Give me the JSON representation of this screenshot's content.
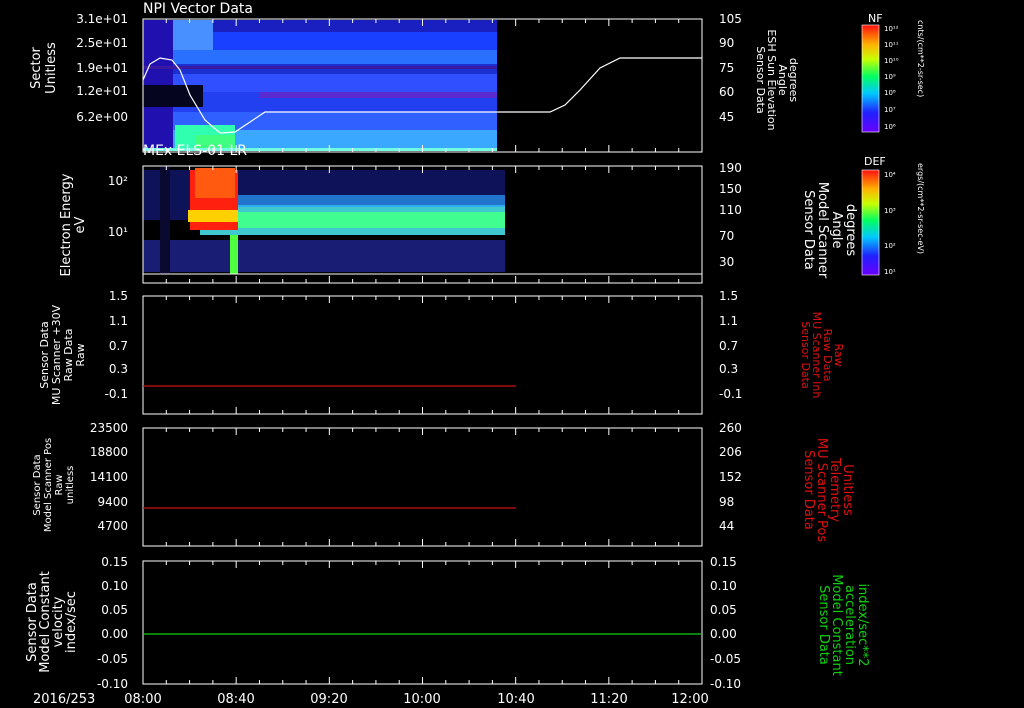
{
  "colors": {
    "background": "#000000",
    "axis": "#ffffff",
    "red_trace": "#d01010",
    "green_trace": "#10d010"
  },
  "time_axis": {
    "date": "2016/253",
    "ticks": [
      "08:00",
      "08:40",
      "09:20",
      "10:00",
      "10:40",
      "11:20",
      "12:00"
    ]
  },
  "panels": [
    {
      "title": "NPI Vector Data",
      "left_ylabel": [
        "Sector",
        "Unitless"
      ],
      "left_ticks": [
        "3.1e+01",
        "2.5e+01",
        "1.9e+01",
        "1.2e+01",
        "6.2e+00"
      ],
      "right_ylabel": [
        "Sensor Data",
        "ESH Sun Elevation",
        "Angle",
        "degrees"
      ],
      "right_ticks": [
        "105",
        "90",
        "75",
        "60",
        "45"
      ],
      "colorbar": {
        "label": "NF",
        "units": "cnts/(cm**2-sr-sec)",
        "ticks": [
          "10¹²",
          "10¹¹",
          "10¹⁰",
          "10⁹",
          "10⁸",
          "10⁷",
          "10⁶"
        ]
      }
    },
    {
      "title": "MEx ELS-01 LR",
      "left_ylabel": [
        "Electron Energy",
        "eV"
      ],
      "left_ticks": [
        "10²",
        "10¹"
      ],
      "right_ylabel": [
        "Sensor Data",
        "Model Scanner",
        "Angle",
        "degrees"
      ],
      "right_ticks": [
        "190",
        "150",
        "110",
        "70",
        "30"
      ],
      "colorbar": {
        "label": "DEF",
        "units": "ergs/(cm**2-sr-sec-eV)",
        "ticks": [
          "10⁴",
          "10³",
          "10²",
          "10¹"
        ]
      }
    },
    {
      "left_ylabel": [
        "Sensor Data",
        "MU Scanner +30V",
        "Raw Data",
        "Raw"
      ],
      "left_ticks": [
        "1.5",
        "1.1",
        "0.7",
        "0.3",
        "-0.1"
      ],
      "right_ylabel": [
        "Sensor Data",
        "MU Scanner Inh",
        "Raw Data",
        "Raw"
      ],
      "right_ticks": [
        "1.5",
        "1.1",
        "0.7",
        "0.3",
        "-0.1"
      ]
    },
    {
      "left_ylabel": [
        "Sensor Data",
        "Model Scanner Pos",
        "Raw",
        "unitless"
      ],
      "left_ticks": [
        "23500",
        "18800",
        "14100",
        "9400",
        "4700"
      ],
      "right_ylabel": [
        "Sensor Data",
        "MU Scanner Pos",
        "Telemetry",
        "Unitless"
      ],
      "right_ticks": [
        "260",
        "206",
        "152",
        "98",
        "44"
      ]
    },
    {
      "left_ylabel": [
        "Sensor Data",
        "Model Constant",
        "velocity",
        "index/sec"
      ],
      "left_ticks": [
        "0.15",
        "0.10",
        "0.05",
        "0.00",
        "-0.05",
        "-0.10"
      ],
      "right_ylabel": [
        "Sensor Data",
        "Model Constant",
        "acceleration",
        "index/sec**2"
      ],
      "right_ticks": [
        "0.15",
        "0.10",
        "0.05",
        "0.00",
        "-0.05",
        "-0.10"
      ]
    }
  ],
  "chart_data": [
    {
      "type": "heatmap",
      "title": "NPI Vector Data",
      "xlabel": "",
      "ylabel": "Sector Unitless",
      "x_range": [
        "08:00",
        "12:00"
      ],
      "data_coverage": [
        "08:00",
        "10:35"
      ],
      "overlay_line": {
        "name": "Sensor Data ESH Sun Elevation Angle",
        "units": "degrees",
        "points": [
          [
            "08:00",
            73
          ],
          [
            "08:10",
            80
          ],
          [
            "08:18",
            78
          ],
          [
            "08:30",
            45
          ],
          [
            "08:40",
            42
          ],
          [
            "08:55",
            50
          ],
          [
            "10:00",
            50
          ],
          [
            "10:40",
            50
          ],
          [
            "10:55",
            55
          ],
          [
            "11:15",
            80
          ],
          [
            "12:00",
            80
          ]
        ]
      }
    },
    {
      "type": "heatmap",
      "title": "MEx ELS-01 LR",
      "xlabel": "",
      "ylabel": "Electron Energy eV",
      "y_scale": "log",
      "x_range": [
        "08:00",
        "12:00"
      ],
      "data_coverage": [
        "08:00",
        "10:36"
      ],
      "overlay_line": {
        "name": "Sensor Data Model Scanner Angle",
        "units": "degrees",
        "points": [
          [
            "08:00",
            10
          ],
          [
            "12:00",
            10
          ]
        ]
      }
    },
    {
      "type": "line",
      "series": [
        {
          "name": "Sensor Data MU Scanner +30V Raw Data",
          "x": [
            "08:00",
            "10:40"
          ],
          "values": [
            0,
            0
          ]
        }
      ],
      "ylim": [
        -0.3,
        1.5
      ]
    },
    {
      "type": "line",
      "series": [
        {
          "name": "Sensor Data Model Scanner Pos Raw",
          "x": [
            "08:00",
            "10:40"
          ],
          "values": [
            7800,
            7800
          ]
        }
      ],
      "ylim": [
        0,
        23500
      ]
    },
    {
      "type": "line",
      "series": [
        {
          "name": "Sensor Data Model Constant velocity",
          "x": [
            "08:00",
            "12:00"
          ],
          "values": [
            0,
            0
          ]
        }
      ],
      "ylim": [
        -0.1,
        0.15
      ]
    }
  ]
}
